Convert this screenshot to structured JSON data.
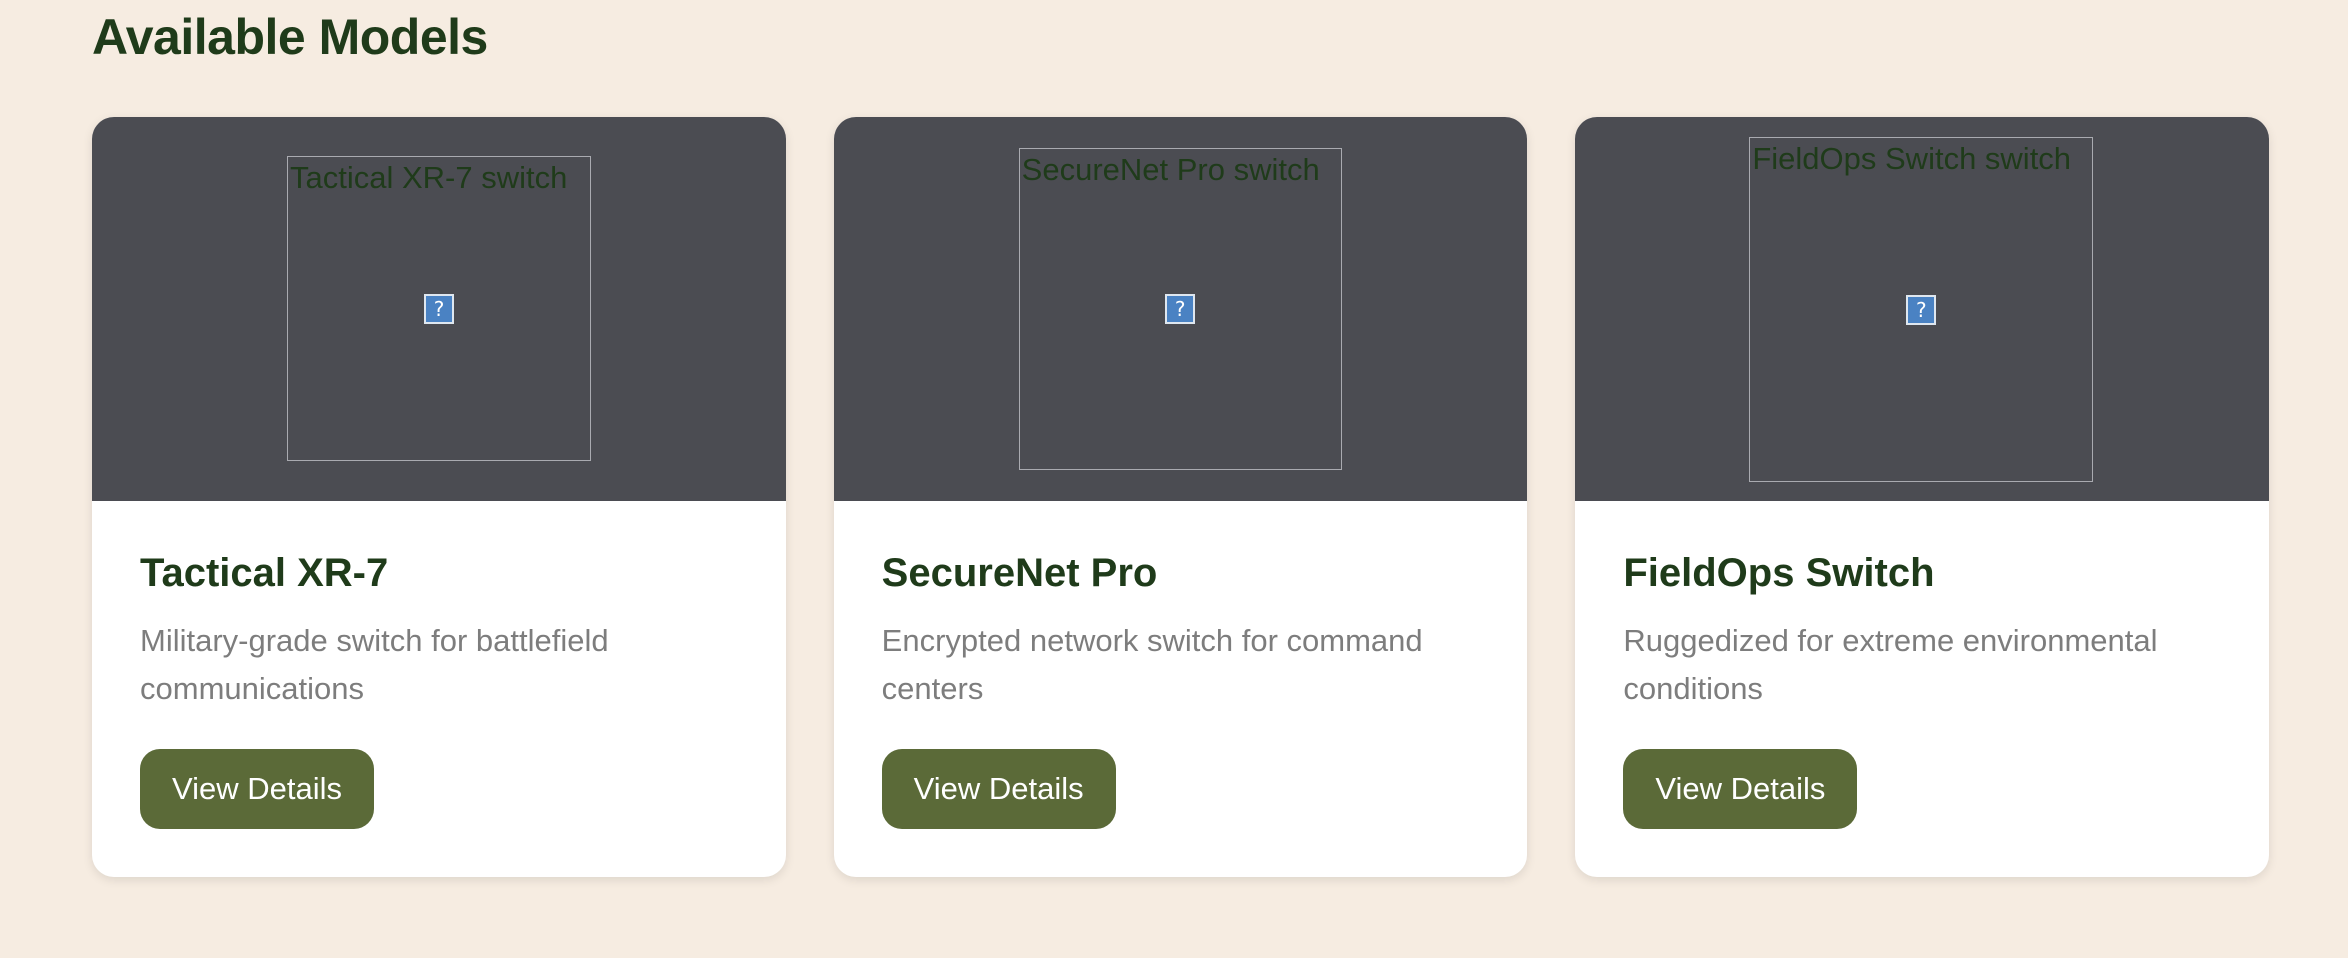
{
  "section": {
    "title": "Available Models"
  },
  "products": [
    {
      "image_alt": "Tactical XR-7 switch",
      "name": "Tactical XR-7",
      "description": "Military-grade switch for battlefield communications",
      "button_label": "View Details"
    },
    {
      "image_alt": "SecureNet Pro switch",
      "name": "SecureNet Pro",
      "description": "Encrypted network switch for command centers",
      "button_label": "View Details"
    },
    {
      "image_alt": "FieldOps Switch switch",
      "name": "FieldOps Switch",
      "description": "Ruggedized for extreme environmental conditions",
      "button_label": "View Details"
    }
  ],
  "icons": {
    "broken_image": "broken-image-icon",
    "broken_image_glyph": "?"
  },
  "colors": {
    "background": "#f6ece1",
    "heading": "#1f3b1a",
    "media_background": "#4b4c52",
    "button": "#5b6a38",
    "description": "#7d7d7d"
  }
}
